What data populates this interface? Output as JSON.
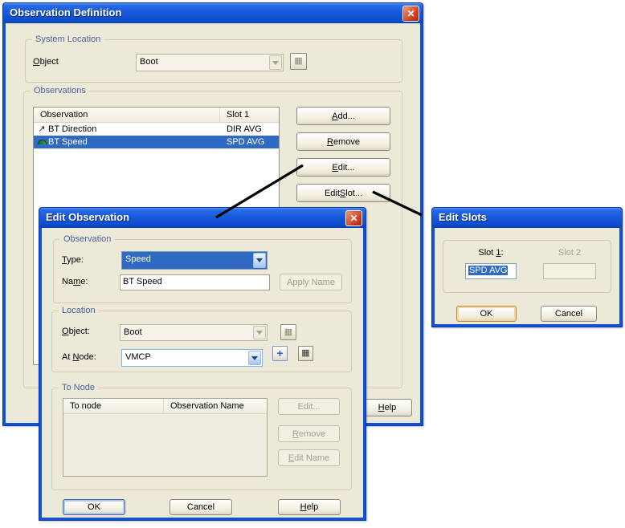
{
  "windows": {
    "observation_definition": {
      "title": "Observation Definition",
      "close_label": "✕",
      "system_location": {
        "label": "System Location",
        "object_label": {
          "text": "Object",
          "key": 0
        },
        "object_value": "Boot"
      },
      "observations": {
        "label": "Observations",
        "columns": [
          "Observation",
          "Slot 1"
        ],
        "rows": [
          {
            "name": "BT Direction",
            "slot1": "DIR AVG"
          },
          {
            "name": "BT Speed",
            "slot1": "SPD AVG"
          }
        ],
        "buttons": {
          "add": {
            "text": "Add...",
            "key": 0
          },
          "remove": {
            "text": "Remove",
            "key": 0
          },
          "edit": {
            "text": "Edit...",
            "key": 0
          },
          "edit_slot": {
            "text": "Edit Slot...",
            "key": 5
          }
        }
      },
      "help_button": {
        "text": "Help",
        "key": 0
      }
    },
    "edit_observation": {
      "title": "Edit Observation",
      "close_label": "✕",
      "observation_group": {
        "label": "Observation",
        "type_label": {
          "text": "Type:",
          "key": 0
        },
        "type_value": "Speed",
        "name_label": {
          "text": "Name:",
          "key": 2
        },
        "name_value": "BT Speed",
        "apply_name_button": {
          "text": "Apply Name"
        }
      },
      "location_group": {
        "label": "Location",
        "object_label": {
          "text": "Object:",
          "key": 0
        },
        "object_value": "Boot",
        "at_node_label": {
          "text": "At Node:",
          "key": 3
        },
        "at_node_value": "VMCP"
      },
      "to_node_group": {
        "label": "To Node",
        "columns": [
          "To node",
          "Observation Name"
        ],
        "buttons": {
          "edit": {
            "text": "Edit..."
          },
          "remove": {
            "text": "Remove",
            "key": 0
          },
          "edit_name": {
            "text": "Edit Name",
            "key": 0
          }
        }
      },
      "ok_button": {
        "text": "OK"
      },
      "cancel_button": {
        "text": "Cancel"
      },
      "help_button": {
        "text": "Help",
        "key": 0
      }
    },
    "edit_slots": {
      "title": "Edit Slots",
      "slot1_label": {
        "text": "Slot 1:",
        "key": 5
      },
      "slot1_value": "SPD AVG",
      "slot2_label": {
        "text": "Slot 2"
      },
      "ok_button": {
        "text": "OK"
      },
      "cancel_button": {
        "text": "Cancel"
      }
    }
  },
  "icons": {
    "direction_row_icon": "↗",
    "grid_button_glyph": "▦",
    "plus_button_glyph": "+"
  },
  "colors": {
    "selection_blue": "#316AC5",
    "dialog_background": "#ECE9D8",
    "titlebar_blue": "#1A5CDE",
    "close_button_red": "#CE3D1E",
    "group_label_blue": "#4C619B"
  }
}
